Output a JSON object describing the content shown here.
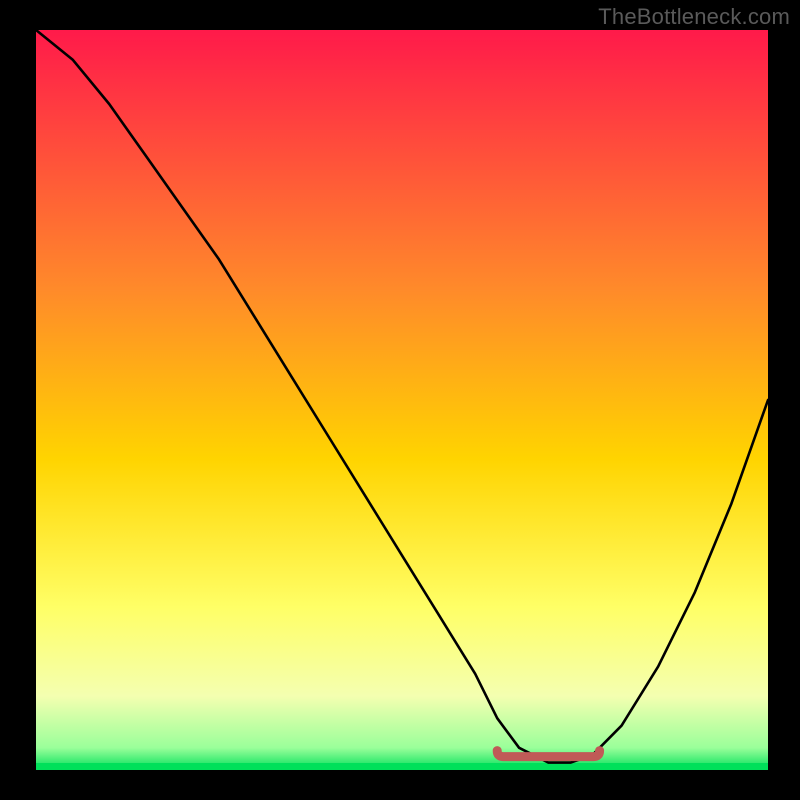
{
  "watermark": "TheBottleneck.com",
  "colors": {
    "black": "#000000",
    "curve": "#000000",
    "marker": "#c05a57",
    "gradient_top": "#ff1a4a",
    "gradient_mid1": "#ff6a3a",
    "gradient_mid2": "#ffd400",
    "gradient_mid3": "#ffff66",
    "gradient_mid4": "#e8ff9a",
    "gradient_bottom": "#00e05a"
  },
  "chart_data": {
    "type": "line",
    "title": "",
    "xlabel": "",
    "ylabel": "",
    "xlim": [
      0,
      100
    ],
    "ylim": [
      0,
      100
    ],
    "series": [
      {
        "name": "bottleneck-curve",
        "x": [
          0,
          5,
          10,
          15,
          20,
          25,
          30,
          35,
          40,
          45,
          50,
          55,
          60,
          63,
          66,
          70,
          73,
          76,
          80,
          85,
          90,
          95,
          100
        ],
        "y": [
          100,
          96,
          90,
          83,
          76,
          69,
          61,
          53,
          45,
          37,
          29,
          21,
          13,
          7,
          3,
          1,
          1,
          2,
          6,
          14,
          24,
          36,
          50
        ]
      }
    ],
    "optimal_range_x": [
      63,
      77
    ],
    "marker_y": 1
  }
}
